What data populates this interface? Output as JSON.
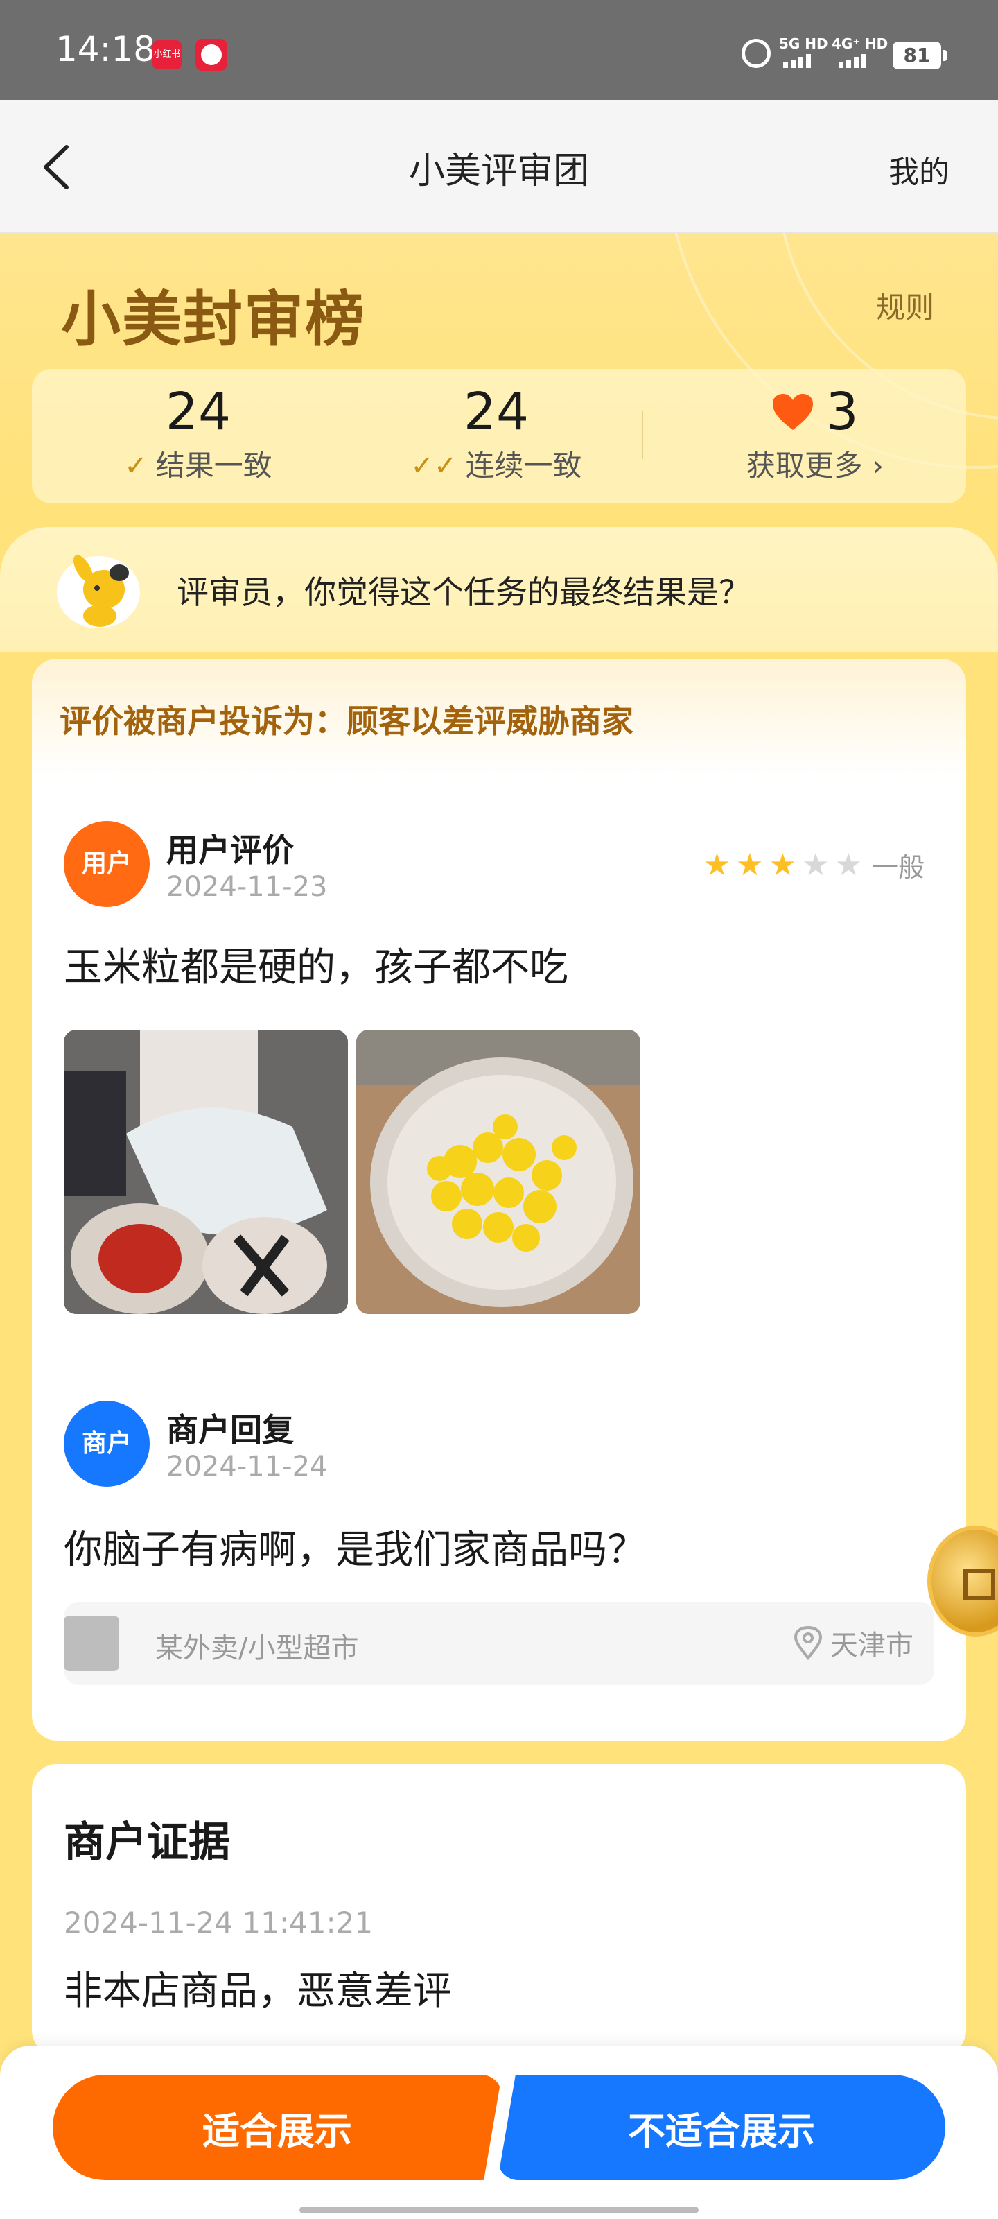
{
  "status_bar": {
    "time": "14:18",
    "app_badge_1": "小红书",
    "network_1": "5G HD",
    "network_2": "4G⁺ HD",
    "battery": "81"
  },
  "nav": {
    "title": "小美评审团",
    "mine_label": "我的"
  },
  "header": {
    "logo_text": "小美封审榜",
    "rules_label": "规则",
    "stats": [
      {
        "value": "24",
        "label": "结果一致"
      },
      {
        "value": "24",
        "label": "连续一致"
      },
      {
        "value": "3",
        "label": "获取更多 ›"
      }
    ]
  },
  "question": {
    "text": "评审员，你觉得这个任务的最终结果是？"
  },
  "review_card": {
    "complaint": "评价被商户投诉为：顾客以差评威胁商家",
    "user_avatar_label": "用户",
    "user_title": "用户评价",
    "user_date": "2024-11-23",
    "rating_stars": 3,
    "rating_max": 5,
    "rating_label": "一般",
    "review_text": "玉米粒都是硬的，孩子都不吃",
    "merchant_avatar_label": "商户",
    "merchant_title": "商户回复",
    "merchant_date": "2024-11-24",
    "reply_text": "你脑子有病啊，是我们家商品吗？",
    "shop_name": "某外卖/小型超市",
    "shop_location": "天津市"
  },
  "evidence_card": {
    "title": "商户证据",
    "date": "2024-11-24 11:41:21",
    "text": "非本店商品，恶意差评"
  },
  "actions": {
    "suitable": "适合展示",
    "unsuitable": "不适合展示"
  },
  "colors": {
    "accent_orange": "#ff6a00",
    "accent_blue": "#1677ff",
    "background_yellow": "#ffe37a",
    "complaint_text": "#a3620c"
  }
}
